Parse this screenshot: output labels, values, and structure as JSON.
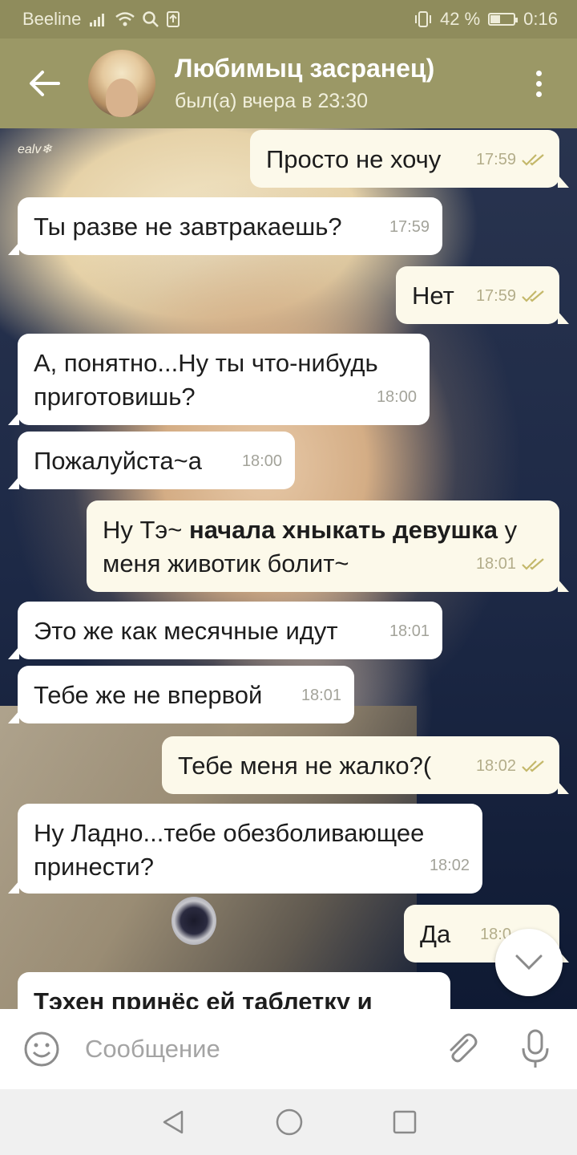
{
  "status_bar": {
    "carrier": "Beeline",
    "battery": "42 %",
    "battery_level": 0.42,
    "time": "0:16"
  },
  "header": {
    "contact_name": "Любимыц засранец)",
    "last_seen": "был(а) вчера в 23:30"
  },
  "chat": {
    "watermark": "ealv❄",
    "messages": [
      {
        "dir": "out",
        "text": "Просто не хочу",
        "time": "17:59"
      },
      {
        "dir": "in",
        "text": "Ты разве не завтракаешь?",
        "time": "17:59"
      },
      {
        "dir": "out",
        "text": "Нет",
        "time": "17:59"
      },
      {
        "dir": "in",
        "text": "А, понятно...Ну ты что-нибудь приготовишь?",
        "time": "18:00"
      },
      {
        "dir": "in",
        "text": "Пожалуйста~а",
        "time": "18:00"
      },
      {
        "dir": "out",
        "text_before": "Ну Тэ~ ",
        "text_bold": "начала хныкать девушка",
        "text_after": " у меня животик болит~",
        "time": "18:01"
      },
      {
        "dir": "in",
        "text": "Это же как месячные идут",
        "time": "18:01"
      },
      {
        "dir": "in",
        "text": "Тебе же не впервой",
        "time": "18:01"
      },
      {
        "dir": "out",
        "text": "Тебе меня не жалко?(",
        "time": "18:02"
      },
      {
        "dir": "in",
        "text": "Ну Ладно...тебе обезболивающее принести?",
        "time": "18:02"
      },
      {
        "dir": "out",
        "text": "Да",
        "time": "18:0"
      },
      {
        "dir": "in",
        "text": "Тэхен принёс ей таблетку и"
      }
    ]
  },
  "input": {
    "placeholder": "Сообщение"
  },
  "colors": {
    "header": "#9b9866",
    "status_bar": "#8f8c5c",
    "incoming_bubble": "#ffffff",
    "outgoing_bubble": "#fcf9ea",
    "read_check": "#c4b86a"
  }
}
